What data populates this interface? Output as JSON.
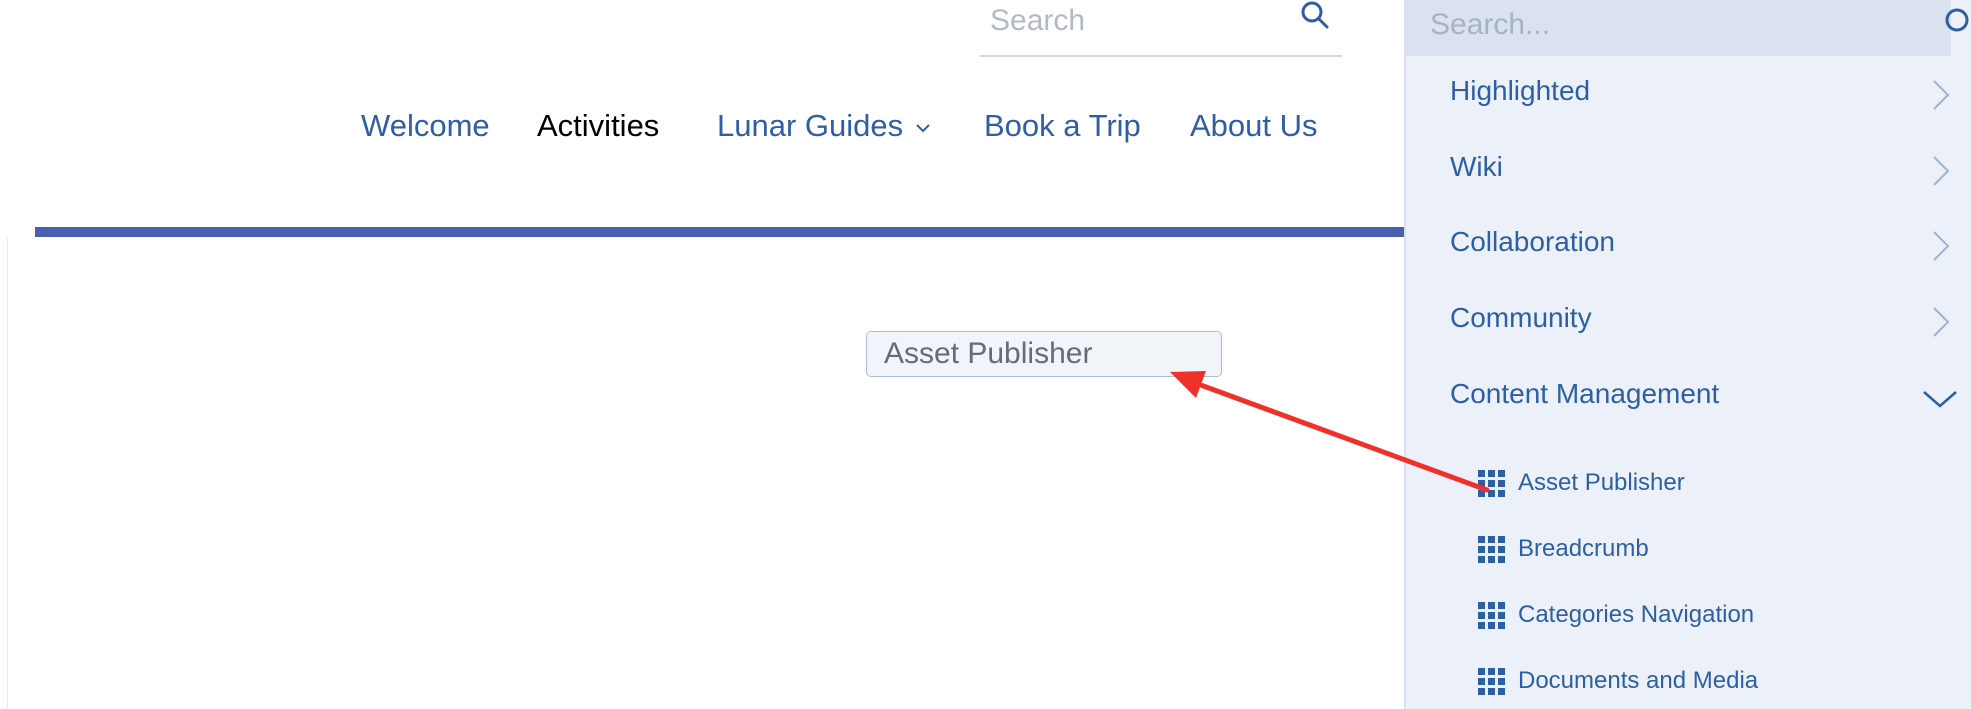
{
  "header": {
    "search_placeholder": "Search",
    "search_icon": "search-icon"
  },
  "nav": {
    "items": [
      {
        "label": "Welcome",
        "active": false
      },
      {
        "label": "Activities",
        "active": true
      },
      {
        "label": "Lunar Guides",
        "active": false,
        "has_dropdown": true
      },
      {
        "label": "Book a Trip",
        "active": false
      },
      {
        "label": "About Us",
        "active": false
      }
    ]
  },
  "drop_target": {
    "label": "Asset Publisher"
  },
  "panel": {
    "search_placeholder": "Search...",
    "search_icon": "search-icon",
    "categories": [
      {
        "label": "Highlighted",
        "expanded": false
      },
      {
        "label": "Wiki",
        "expanded": false
      },
      {
        "label": "Collaboration",
        "expanded": false
      },
      {
        "label": "Community",
        "expanded": false
      },
      {
        "label": "Content Management",
        "expanded": true
      }
    ],
    "widgets": [
      {
        "label": "Asset Publisher",
        "icon": "grid-icon"
      },
      {
        "label": "Breadcrumb",
        "icon": "grid-icon"
      },
      {
        "label": "Categories Navigation",
        "icon": "grid-icon"
      },
      {
        "label": "Documents and Media",
        "icon": "grid-icon"
      }
    ]
  },
  "colors": {
    "link": "#2f5ea4",
    "accent_rule": "#4a5fae",
    "panel_bg": "#ecf1f9",
    "annotation_arrow": "#f0302a"
  }
}
